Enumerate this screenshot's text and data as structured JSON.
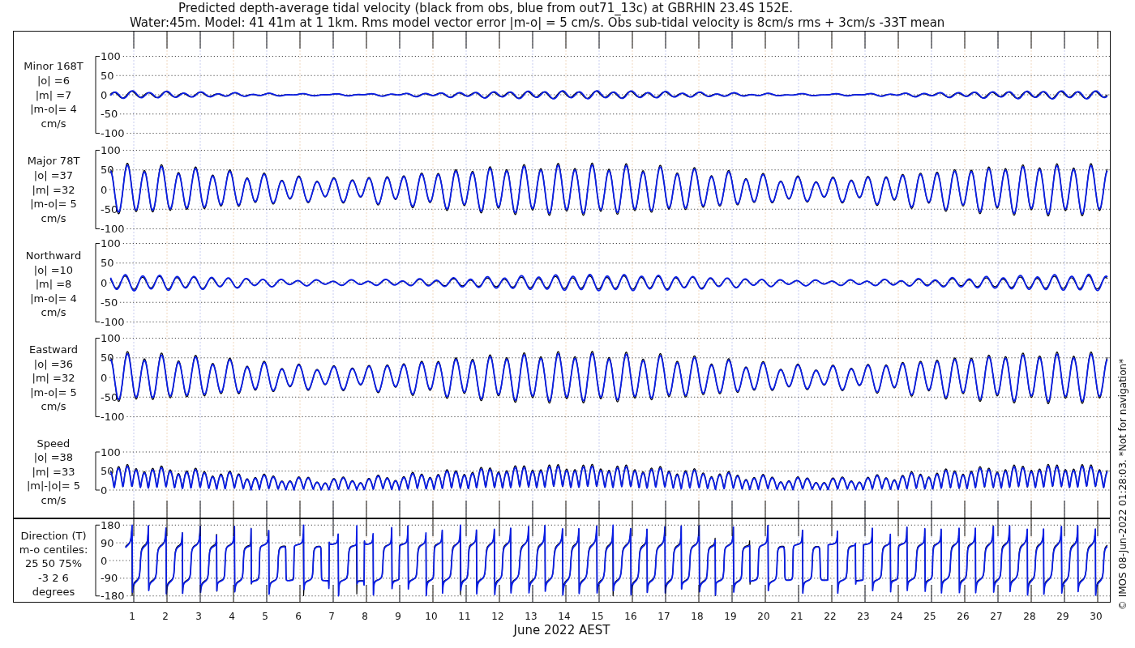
{
  "title": "Predicted depth-average tidal velocity (black from obs, blue from out71_13c) at GBRHIN 23.4S 152E.",
  "subtitle": "Water:45m. Model: 41 41m at 1 1km. Rms model vector error |m-o| = 5 cm/s. Obs sub-tidal velocity is 8cm/s rms + 3cm/s -33T mean",
  "panels": [
    {
      "kind": "minor",
      "label_lines": [
        "Minor 168T",
        "|o| =6",
        "|m| =7",
        "|m-o|= 4",
        "cm/s"
      ],
      "yticks": [
        "100",
        "50",
        "0",
        "-50",
        "-100"
      ]
    },
    {
      "kind": "major",
      "label_lines": [
        "Major 78T",
        "|o| =37",
        "|m| =32",
        "|m-o|= 5",
        "cm/s"
      ],
      "yticks": [
        "100",
        "50",
        "0",
        "-50",
        "-100"
      ]
    },
    {
      "kind": "north",
      "label_lines": [
        "Northward",
        "|o| =10",
        "|m| =8",
        "|m-o|= 4",
        "cm/s"
      ],
      "yticks": [
        "100",
        "50",
        "0",
        "-50",
        "-100"
      ]
    },
    {
      "kind": "east",
      "label_lines": [
        "Eastward",
        "|o| =36",
        "|m| =32",
        "|m-o|= 5",
        "cm/s"
      ],
      "yticks": [
        "100",
        "50",
        "0",
        "-50",
        "-100"
      ]
    },
    {
      "kind": "speed",
      "label_lines": [
        "Speed",
        "|o| =38",
        "|m| =33",
        "|m|-|o|= 5",
        "cm/s"
      ],
      "yticks": [
        "100",
        "50",
        "0"
      ]
    },
    {
      "kind": "direction",
      "label_lines": [
        "Direction (T)",
        "m-o centiles:",
        "25  50  75%",
        "-3  2  6",
        "degrees"
      ],
      "yticks": [
        "180",
        "90",
        "0",
        "-90",
        "-180"
      ]
    }
  ],
  "xticks": [
    "1",
    "2",
    "3",
    "4",
    "5",
    "6",
    "7",
    "8",
    "9",
    "10",
    "11",
    "12",
    "13",
    "14",
    "15",
    "16",
    "17",
    "18",
    "19",
    "20",
    "21",
    "22",
    "23",
    "24",
    "25",
    "26",
    "27",
    "28",
    "29",
    "30"
  ],
  "xlabel": "June 2022 AEST",
  "note": "© IMOS 08-Jun-2022 01:28:03. *Not for navigation*"
}
